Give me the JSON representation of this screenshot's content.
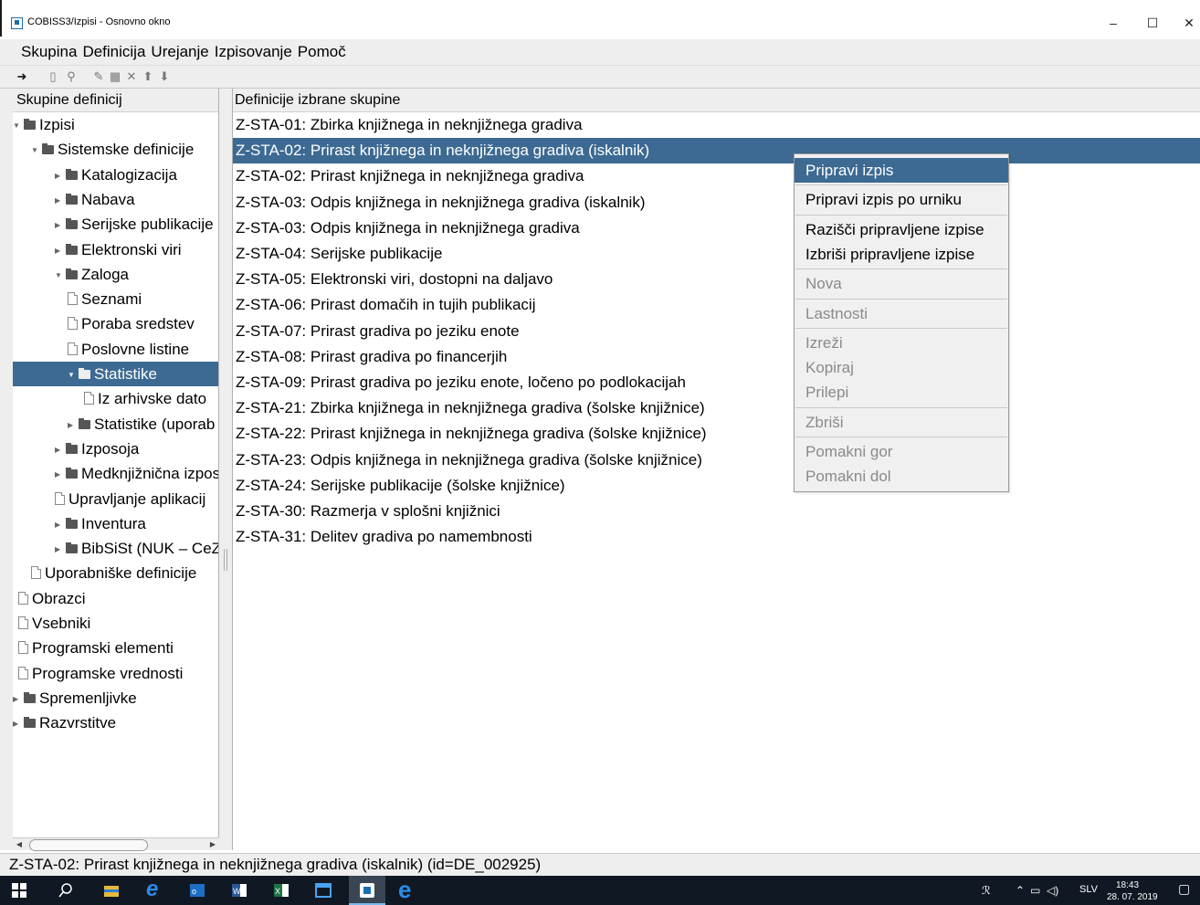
{
  "window": {
    "title": "COBISS3/Izpisi - Osnovno okno",
    "minimize": "–",
    "maximize": "☐",
    "close": "✕"
  },
  "menu": [
    "Skupina",
    "Definicija",
    "Urejanje",
    "Izpisovanje",
    "Pomoč"
  ],
  "left_panel": {
    "header": "Skupine definicij",
    "tree": [
      {
        "label": "Izpisi",
        "type": "folder",
        "expanded": true
      },
      {
        "label": "Sistemske definicije",
        "type": "folder",
        "expanded": true
      },
      {
        "label": "Katalogizacija",
        "type": "folder",
        "expanded": false
      },
      {
        "label": "Nabava",
        "type": "folder",
        "expanded": false
      },
      {
        "label": "Serijske publikacije",
        "type": "folder",
        "expanded": false
      },
      {
        "label": "Elektronski viri",
        "type": "folder",
        "expanded": false
      },
      {
        "label": "Zaloga",
        "type": "folder",
        "expanded": true
      },
      {
        "label": "Seznami",
        "type": "doc"
      },
      {
        "label": "Poraba sredstev",
        "type": "doc"
      },
      {
        "label": "Poslovne listine",
        "type": "doc"
      },
      {
        "label": "Statistike",
        "type": "folder",
        "expanded": true,
        "selected": true
      },
      {
        "label": "Iz arhivske dato",
        "type": "doc"
      },
      {
        "label": "Statistike (uporab",
        "type": "folder",
        "expanded": false
      },
      {
        "label": "Izposoja",
        "type": "folder",
        "expanded": false
      },
      {
        "label": "Medknjižnična izpos",
        "type": "folder",
        "expanded": false
      },
      {
        "label": "Upravljanje aplikacij",
        "type": "doc"
      },
      {
        "label": "Inventura",
        "type": "folder",
        "expanded": false
      },
      {
        "label": "BibSiSt (NUK – CeZ",
        "type": "folder",
        "expanded": false
      },
      {
        "label": "Uporabniške definicije",
        "type": "doc"
      },
      {
        "label": "Obrazci",
        "type": "doc"
      },
      {
        "label": "Vsebniki",
        "type": "doc"
      },
      {
        "label": "Programski elementi",
        "type": "doc"
      },
      {
        "label": "Programske vrednosti",
        "type": "doc"
      },
      {
        "label": "Spremenljivke",
        "type": "folder",
        "expanded": false
      },
      {
        "label": "Razvrstitve",
        "type": "folder",
        "expanded": false
      }
    ]
  },
  "right_panel": {
    "header": "Definicije izbrane skupine",
    "items": [
      "Z-STA-01: Zbirka knjižnega in neknjižnega gradiva",
      "Z-STA-02: Prirast knjižnega in neknjižnega gradiva (iskalnik)",
      "Z-STA-02: Prirast knjižnega in neknjižnega gradiva",
      "Z-STA-03: Odpis knjižnega in neknjižnega gradiva (iskalnik)",
      "Z-STA-03: Odpis knjižnega in neknjižnega gradiva",
      "Z-STA-04: Serijske publikacije",
      "Z-STA-05: Elektronski viri, dostopni na daljavo",
      "Z-STA-06: Prirast domačih in tujih publikacij",
      "Z-STA-07: Prirast gradiva po jeziku enote",
      "Z-STA-08: Prirast gradiva po financerjih",
      "Z-STA-09: Prirast gradiva po jeziku enote, ločeno po podlokacijah",
      "Z-STA-21: Zbirka knjižnega in neknjižnega gradiva (šolske knjižnice)",
      "Z-STA-22: Prirast knjižnega in neknjižnega gradiva (šolske knjižnice)",
      "Z-STA-23: Odpis knjižnega in neknjižnega gradiva (šolske knjižnice)",
      "Z-STA-24: Serijske publikacije (šolske knjižnice)",
      "Z-STA-30: Razmerja v splošni knjižnici",
      "Z-STA-31: Delitev gradiva po namembnosti"
    ],
    "selected_index": 1
  },
  "context_menu": {
    "groups": [
      [
        {
          "label": "Pripravi izpis",
          "enabled": true,
          "highlighted": true
        }
      ],
      [
        {
          "label": "Pripravi izpis po urniku",
          "enabled": true
        }
      ],
      [
        {
          "label": "Razišči pripravljene izpise",
          "enabled": true
        },
        {
          "label": "Izbriši pripravljene izpise",
          "enabled": true
        }
      ],
      [
        {
          "label": "Nova",
          "enabled": false
        }
      ],
      [
        {
          "label": "Lastnosti",
          "enabled": false
        }
      ],
      [
        {
          "label": "Izreži",
          "enabled": false
        },
        {
          "label": "Kopiraj",
          "enabled": false
        },
        {
          "label": "Prilepi",
          "enabled": false
        }
      ],
      [
        {
          "label": "Zbriši",
          "enabled": false
        }
      ],
      [
        {
          "label": "Pomakni gor",
          "enabled": false
        },
        {
          "label": "Pomakni dol",
          "enabled": false
        }
      ]
    ]
  },
  "status_bar": "Z-STA-02: Prirast knjižnega in neknjižnega gradiva (iskalnik) (id=DE_002925)",
  "taskbar": {
    "language": "SLV",
    "time": "18:43",
    "date": "28. 07. 2019"
  },
  "colors": {
    "selection": "#3c6a93",
    "taskbar": "#101923"
  }
}
